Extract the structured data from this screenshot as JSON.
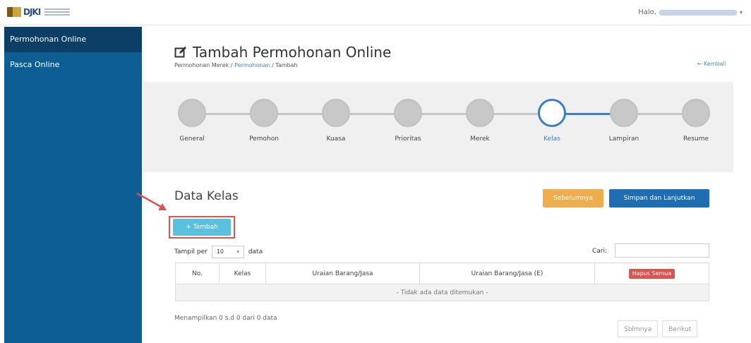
{
  "topbar": {
    "logo_text": "DJKI",
    "greeting": "Halo,"
  },
  "sidebar": {
    "items": [
      {
        "label": "Permohonan Online"
      },
      {
        "label": "Pasca Online"
      }
    ]
  },
  "header": {
    "title": "Tambah Permohonan Online",
    "breadcrumb": {
      "part1": "Permohonan Merek / ",
      "part2": "Permohonan",
      "part3": " / Tambah"
    },
    "back_label": "← Kembali"
  },
  "wizard": {
    "current_index": 5,
    "steps": [
      {
        "label": "General"
      },
      {
        "label": "Pemohon"
      },
      {
        "label": "Kuasa"
      },
      {
        "label": "Prioritas"
      },
      {
        "label": "Merek"
      },
      {
        "label": "Kelas"
      },
      {
        "label": "Lampiran"
      },
      {
        "label": "Resume"
      }
    ]
  },
  "section": {
    "title": "Data Kelas",
    "prev_label": "Sebelumnya",
    "save_label": "Simpan dan Lanjutkan",
    "add_label": "+ Tambah"
  },
  "table_controls": {
    "show_prefix": "Tampil per",
    "show_value": "10",
    "show_suffix": "data",
    "search_label": "Cari:",
    "search_value": ""
  },
  "table": {
    "headers": [
      "No.",
      "Kelas",
      "Uraian Barang/Jasa",
      "Uraian Barang/Jasa (E)"
    ],
    "delete_all_label": "Hapus Semua",
    "empty_text": "- Tidak ada data ditemukan -"
  },
  "footer": {
    "info": "Menampilkan 0 s.d 0 dari 0 data",
    "prev_label": "Sblmnya",
    "next_label": "Berikut"
  },
  "colors": {
    "sidebar": "#0d5e93",
    "sidebar_active": "#0b3f66",
    "accent": "#3a7fc5",
    "warning": "#f0ad4e",
    "primary": "#1f6db3",
    "info": "#5bc0de",
    "danger": "#d9534f"
  }
}
